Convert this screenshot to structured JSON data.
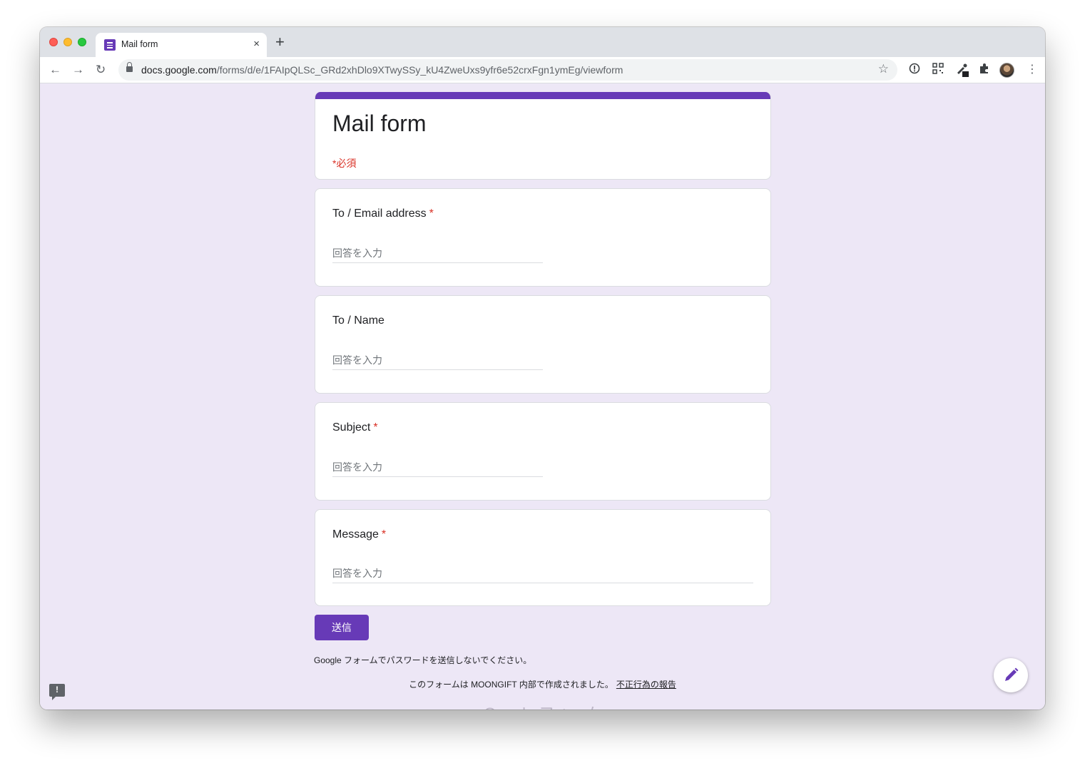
{
  "browser": {
    "tab_title": "Mail form",
    "new_tab_label": "+",
    "close_label": "×",
    "url_host": "docs.google.com",
    "url_path": "/forms/d/e/1FAIpQLSc_GRd2xhDlo9XTwySSy_kU4ZweUxs9yfr6e52crxFgn1ymEg/viewform",
    "extensions": [
      "info-icon",
      "qr-icon",
      "eyedropper-icon",
      "puzzle-icon"
    ]
  },
  "form": {
    "title": "Mail form",
    "required_note": "*必須",
    "placeholder": "回答を入力",
    "questions": [
      {
        "label": "To / Email address",
        "required": true
      },
      {
        "label": "To / Name",
        "required": false
      },
      {
        "label": "Subject",
        "required": true
      },
      {
        "label": "Message",
        "required": true
      }
    ],
    "required_mark": "*",
    "submit_label": "送信",
    "password_note": "Google フォームでパスワードを送信しないでください。",
    "footer_text": "このフォームは MOONGIFT 内部で作成されました。",
    "report_link": "不正行為の報告",
    "brand": "Google フォーム"
  },
  "colors": {
    "accent": "#673ab7",
    "background": "#ede7f6",
    "required": "#d93025"
  }
}
